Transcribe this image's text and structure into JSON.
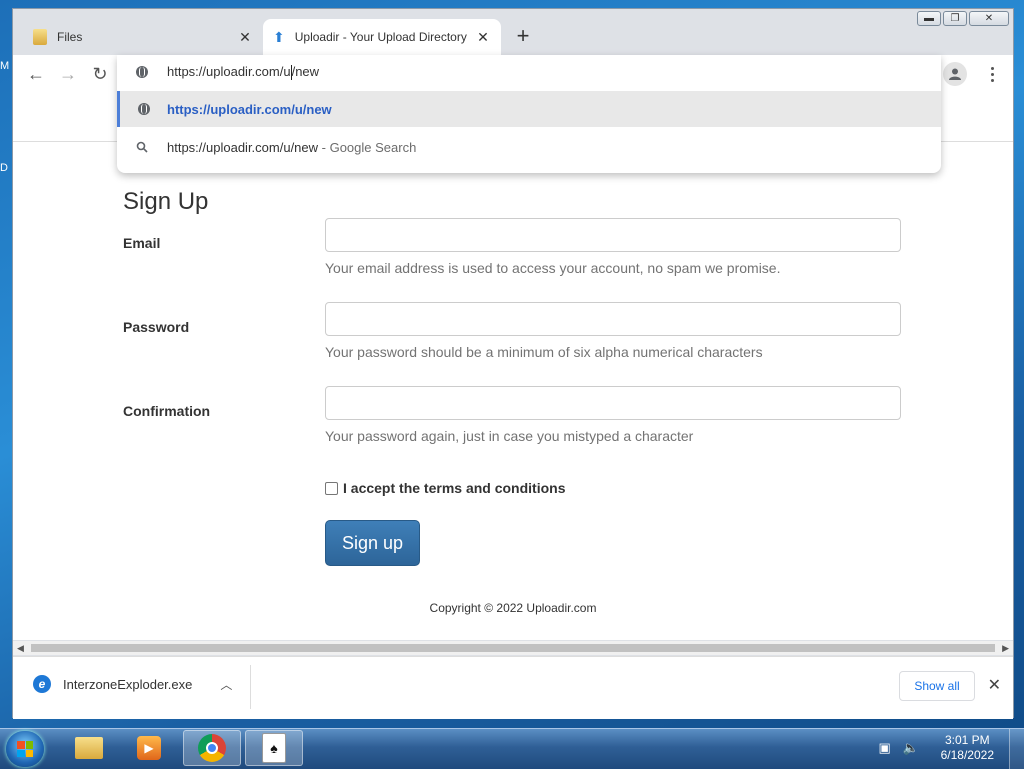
{
  "desktop": {
    "fragments": [
      "M",
      "D"
    ]
  },
  "browser": {
    "tabs": [
      {
        "title": "Files",
        "icon": "folder-icon"
      },
      {
        "title": "Uploadir - Your Upload Directory",
        "icon": "uploadir-icon",
        "active": true
      }
    ],
    "new_tab_icon": "+",
    "omnibox": {
      "typed_prefix": "https://uploadir.com/u",
      "typed_suffix": "/new",
      "suggestions": [
        {
          "text": "https://uploadir.com/u/new",
          "icon": "globe-icon",
          "selected": true
        },
        {
          "text": "https://uploadir.com/u/new",
          "suffix": " - Google Search",
          "icon": "search-icon"
        }
      ]
    }
  },
  "page": {
    "title": "Sign Up",
    "fields": [
      {
        "label": "Email",
        "value": "",
        "help": "Your email address is used to access your account, no spam we promise."
      },
      {
        "label": "Password",
        "value": "",
        "help": "Your password should be a minimum of six alpha numerical characters"
      },
      {
        "label": "Confirmation",
        "value": "",
        "help": "Your password again, just in case you mistyped a character"
      }
    ],
    "terms_label": "I accept the terms and conditions",
    "signup_button": "Sign up",
    "copyright": "Copyright © 2022 Uploadir.com"
  },
  "downloads": {
    "item_name": "InterzoneExploder.exe",
    "show_all": "Show all"
  },
  "taskbar": {
    "time": "3:01 PM",
    "date": "6/18/2022"
  },
  "colors": {
    "accent_link": "#2a5fc4",
    "signup_button": "#3372aa",
    "show_all": "#1a73e8"
  }
}
